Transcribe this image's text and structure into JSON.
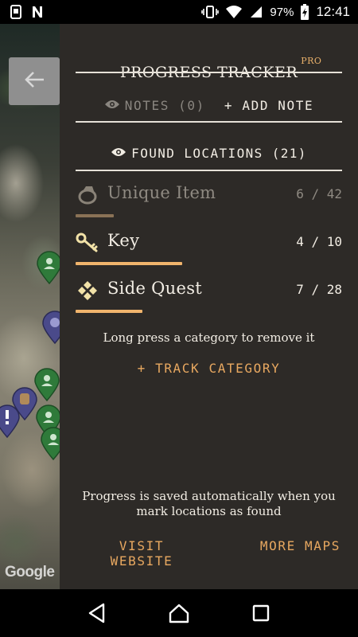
{
  "status_bar": {
    "battery": "97%",
    "time": "12:41"
  },
  "map": {
    "logo": "Google"
  },
  "panel": {
    "title": "PROGRESS TRACKER",
    "badge": "PRO",
    "notes_label": "NOTES (0)",
    "add_note_label": "+ ADD NOTE",
    "found_label": "FOUND LOCATIONS (21)",
    "categories": [
      {
        "name": "Unique Item",
        "count": "6 / 42",
        "found": 6,
        "total": 42,
        "icon": "ring-icon",
        "active": false
      },
      {
        "name": "Key",
        "count": "4 / 10",
        "found": 4,
        "total": 10,
        "icon": "key-icon",
        "active": true
      },
      {
        "name": "Side Quest",
        "count": "7 / 28",
        "found": 7,
        "total": 28,
        "icon": "quest-diamond-icon",
        "active": true
      }
    ],
    "hint": "Long press a category to remove it",
    "track_category_label": "+ TRACK CATEGORY",
    "saved_note": "Progress is saved automatically when you mark locations as found",
    "visit_website_label": "VISIT WEBSITE",
    "more_maps_label": "MORE MAPS"
  },
  "colors": {
    "panel_bg": "#2d2a27",
    "accent": "#e8a860",
    "progress_active": "#f0b46c",
    "progress_inactive": "#8a7256",
    "text": "#f2ede4",
    "muted": "#8a8680"
  }
}
